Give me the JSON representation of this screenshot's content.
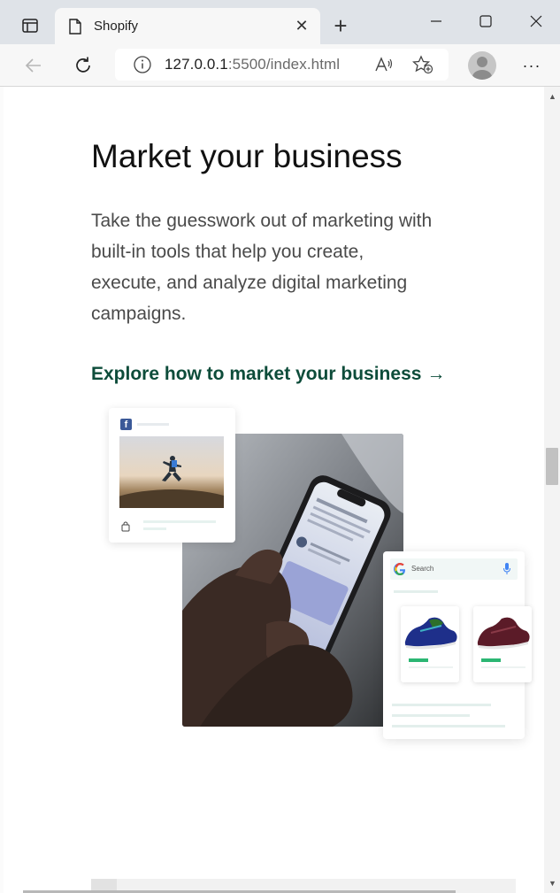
{
  "browser": {
    "tab_title": "Shopify",
    "tab_close": "✕",
    "new_tab": "+",
    "url_host": "127.0.0.1",
    "url_rest": ":5500/index.html",
    "menu": "···"
  },
  "page": {
    "heading": "Market your business",
    "body": "Take the guesswork out of marketing with built-in tools that help you create, execute, and analyze digital marketing campaigns.",
    "cta": "Explore how to market your business",
    "cta_arrow": "→",
    "search_label": "Search"
  },
  "colors": {
    "cta": "#0d4c3a",
    "facebook": "#3b5998",
    "accent_green": "#2bb673"
  }
}
